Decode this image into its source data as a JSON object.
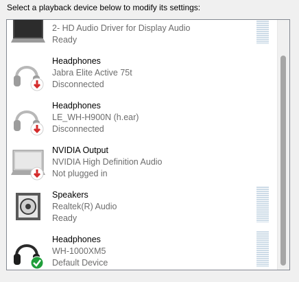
{
  "instruction": "Select a playback device below to modify its settings:",
  "devices": [
    {
      "name": "",
      "description": "2- HD Audio Driver for Display Audio",
      "status": "Ready",
      "icon": "monitor-icon",
      "badge": null,
      "level_meter": true
    },
    {
      "name": "Headphones",
      "description": "Jabra Elite Active 75t",
      "status": "Disconnected",
      "icon": "headphones-icon",
      "badge": "disconnected-arrow-icon",
      "level_meter": false
    },
    {
      "name": "Headphones",
      "description": "LE_WH-H900N (h.ear)",
      "status": "Disconnected",
      "icon": "headphones-icon",
      "badge": "disconnected-arrow-icon",
      "level_meter": false
    },
    {
      "name": "NVIDIA Output",
      "description": "NVIDIA High Definition Audio",
      "status": "Not plugged in",
      "icon": "monitor-icon",
      "badge": "disconnected-arrow-icon",
      "level_meter": false
    },
    {
      "name": "Speakers",
      "description": "Realtek(R) Audio",
      "status": "Ready",
      "icon": "speaker-icon",
      "badge": null,
      "level_meter": true
    },
    {
      "name": "Headphones",
      "description": "WH-1000XM5",
      "status": "Default Device",
      "icon": "headphones-icon",
      "badge": "default-check-icon",
      "level_meter": true
    }
  ],
  "colors": {
    "disconnected_badge": "#d42a2a",
    "default_badge": "#1f9e3a",
    "secondary_text": "#6d6d6d",
    "list_border": "#828790"
  }
}
